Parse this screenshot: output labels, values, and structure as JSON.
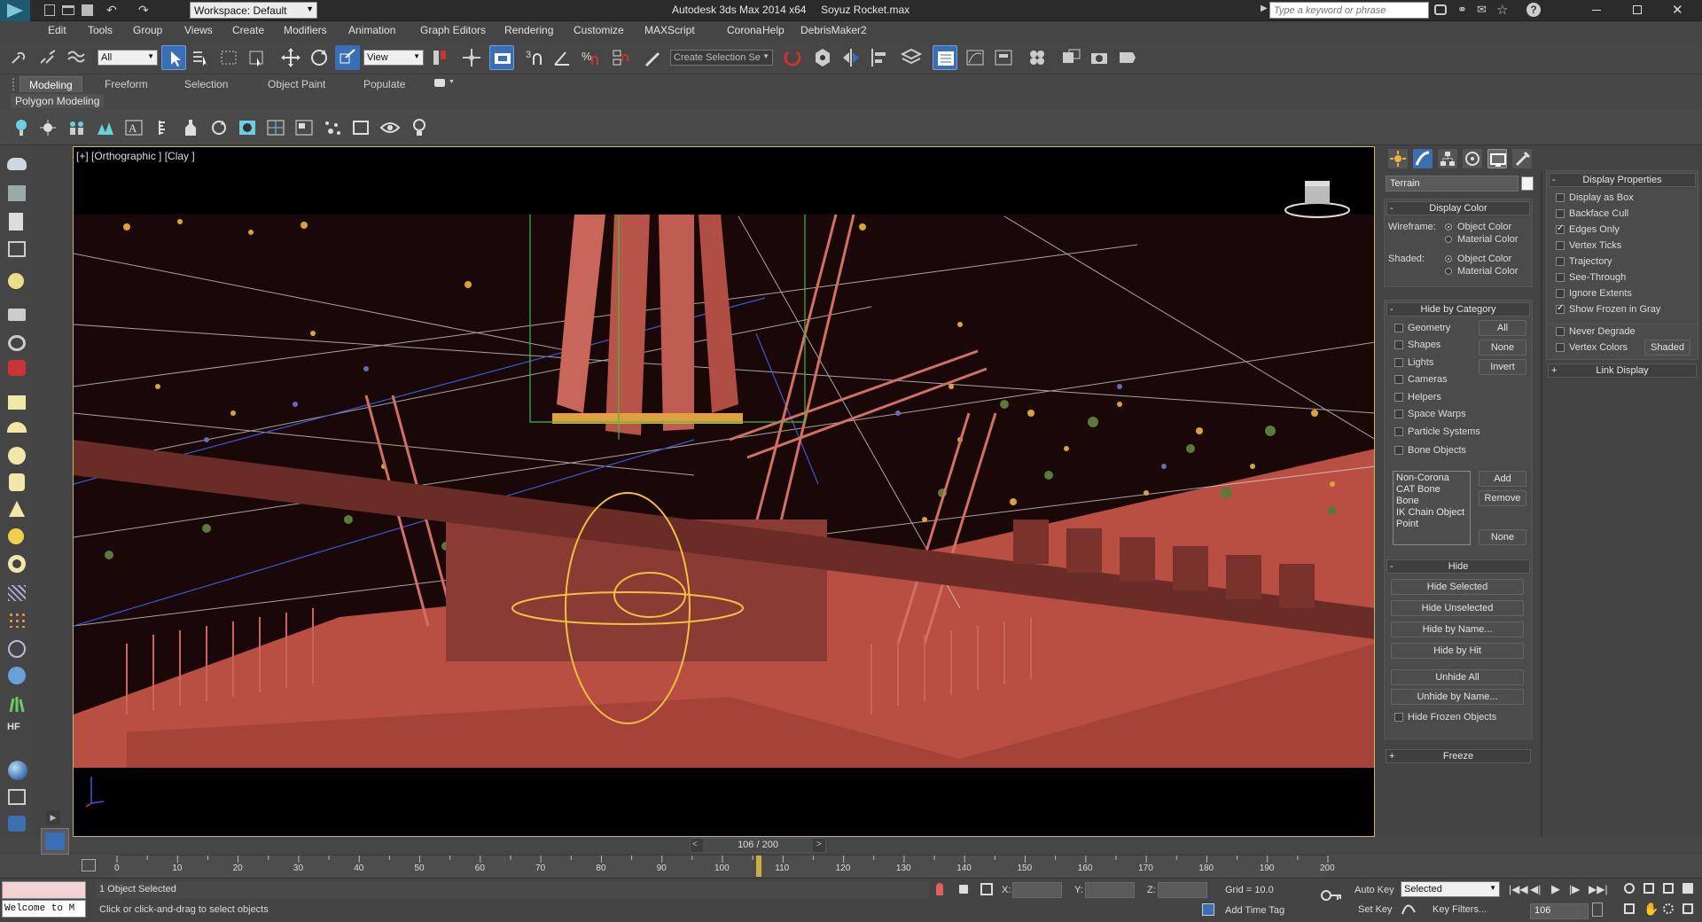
{
  "titlebar": {
    "workspace_label": "Workspace: Default",
    "app_title": "Autodesk 3ds Max  2014 x64",
    "file_name": "Soyuz Rocket.max",
    "search_placeholder": "Type a keyword or phrase"
  },
  "menu": [
    "Edit",
    "Tools",
    "Group",
    "Views",
    "Create",
    "Modifiers",
    "Animation",
    "Graph Editors",
    "Rendering",
    "Customize",
    "MAXScript",
    "Corona",
    "Help",
    "DebrisMaker2"
  ],
  "toolbar": {
    "filter_value": "All",
    "ref_coord_value": "View",
    "selection_set_placeholder": "Create Selection Se"
  },
  "ribbon": {
    "tabs": [
      "Modeling",
      "Freeform",
      "Selection",
      "Object Paint",
      "Populate"
    ],
    "active_tab": "Modeling",
    "panel_label": "Polygon Modeling"
  },
  "viewport": {
    "label": "[+] [Orthographic ] [Clay ]"
  },
  "cmdpanel": {
    "object_name": "Terrain",
    "display_color": {
      "title": "Display Color",
      "wireframe_label": "Wireframe:",
      "shaded_label": "Shaded:",
      "object_color": "Object Color",
      "material_color": "Material Color"
    },
    "hide_by_category": {
      "title": "Hide by Category",
      "items": [
        "Geometry",
        "Shapes",
        "Lights",
        "Cameras",
        "Helpers",
        "Space Warps",
        "Particle Systems",
        "Bone Objects"
      ],
      "btn_all": "All",
      "btn_none": "None",
      "btn_invert": "Invert",
      "list": [
        "Non-Corona",
        "CAT Bone",
        "Bone",
        "IK Chain Object",
        "Point"
      ],
      "btn_add": "Add",
      "btn_remove": "Remove",
      "btn_none2": "None"
    },
    "hide": {
      "title": "Hide",
      "buttons": [
        "Hide Selected",
        "Hide Unselected",
        "Hide by Name...",
        "Hide by Hit",
        "Unhide All",
        "Unhide by Name..."
      ],
      "frozen_label": "Hide Frozen Objects"
    },
    "freeze_title": "Freeze",
    "display_properties": {
      "title": "Display Properties",
      "items": [
        {
          "label": "Display as Box",
          "checked": false
        },
        {
          "label": "Backface Cull",
          "checked": false
        },
        {
          "label": "Edges Only",
          "checked": true
        },
        {
          "label": "Vertex Ticks",
          "checked": false
        },
        {
          "label": "Trajectory",
          "checked": false
        },
        {
          "label": "See-Through",
          "checked": false
        },
        {
          "label": "Ignore Extents",
          "checked": false
        },
        {
          "label": "Show Frozen in Gray",
          "checked": true
        },
        {
          "label": "Never Degrade",
          "checked": false
        },
        {
          "label": "Vertex Colors",
          "checked": false
        }
      ],
      "shaded_btn": "Shaded"
    },
    "link_display_title": "Link Display"
  },
  "timeline": {
    "frame_label": "106 / 200",
    "ticks": [
      "0",
      "10",
      "20",
      "30",
      "40",
      "50",
      "60",
      "70",
      "80",
      "90",
      "100",
      "110",
      "120",
      "130",
      "140",
      "150",
      "160",
      "170",
      "180",
      "190",
      "200"
    ],
    "current_frame": 106,
    "total_frames": 200
  },
  "status": {
    "maxscript_text": "Welcome to M",
    "selected_text": "1 Object Selected",
    "prompt_text": "Click or click-and-drag to select objects",
    "x_label": "X:",
    "y_label": "Y:",
    "z_label": "Z:",
    "grid_text": "Grid = 10.0",
    "add_time_tag": "Add Time Tag",
    "auto_key": "Auto Key",
    "set_key": "Set Key",
    "key_mode_value": "Selected",
    "key_filters": "Key Filters...",
    "frame_field": "106"
  },
  "colors": {
    "accent_blue": "#3b6fb5",
    "viewport_border": "#c9b468",
    "terrain_red": "#b84f42",
    "frame_marker": "#c9b040"
  }
}
